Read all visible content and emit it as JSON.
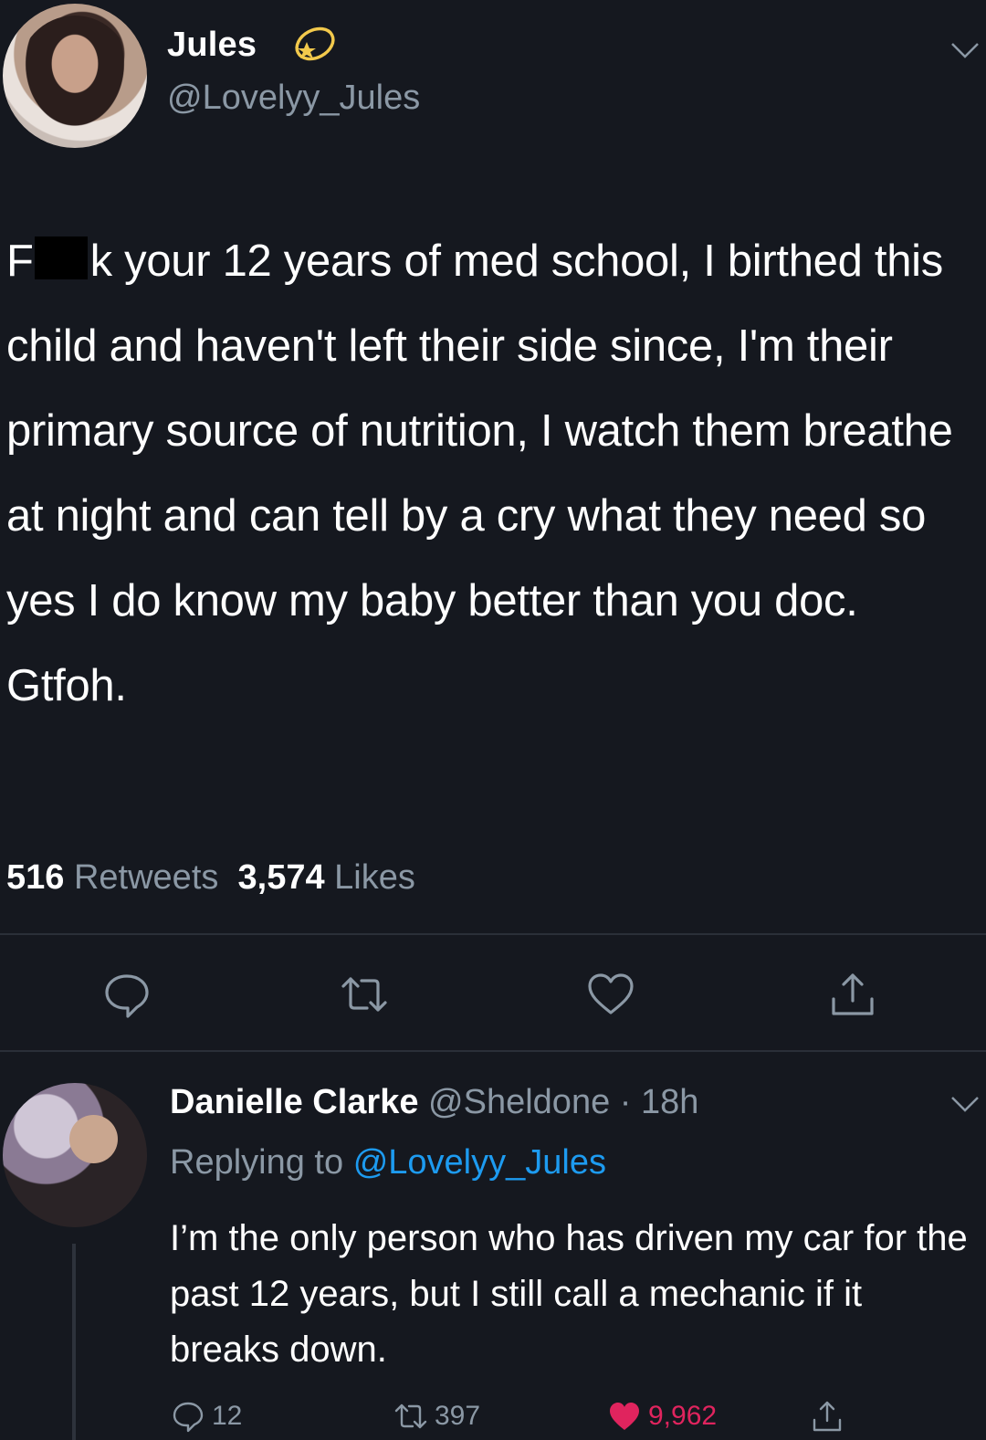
{
  "colors": {
    "background": "#15181f",
    "text_primary": "#ffffff",
    "text_secondary": "#8b98a5",
    "link": "#1d9bf0",
    "like_active": "#e0245e"
  },
  "tweet": {
    "author_name": "Jules",
    "author_handle": "@Lovelyy_Jules",
    "badge_icon": "halo-star-emoji",
    "text_prefix": "F",
    "text_after_censor": "k your 12 years of med school, I birthed this child and haven't left their side since, I'm their primary source of nutrition, I watch them breathe at night and can tell by a cry what they need so yes I do know my baby better than you doc. Gtfoh.",
    "retweets_count": "516",
    "retweets_label": "Retweets",
    "likes_count": "3,574",
    "likes_label": "Likes",
    "actions": [
      "reply-icon",
      "retweet-icon",
      "like-icon",
      "share-icon"
    ]
  },
  "reply": {
    "author_name": "Danielle Clarke",
    "author_handle": "@Sheldone",
    "separator": "·",
    "time": "18h",
    "replying_to_label": "Replying to",
    "replying_to_handle": "@Lovelyy_Jules",
    "text": "I’m the only person who has driven my car for the past 12 years, but I still call a mechanic if it breaks down.",
    "reply_count": "12",
    "retweet_count": "397",
    "like_count": "9,962"
  }
}
